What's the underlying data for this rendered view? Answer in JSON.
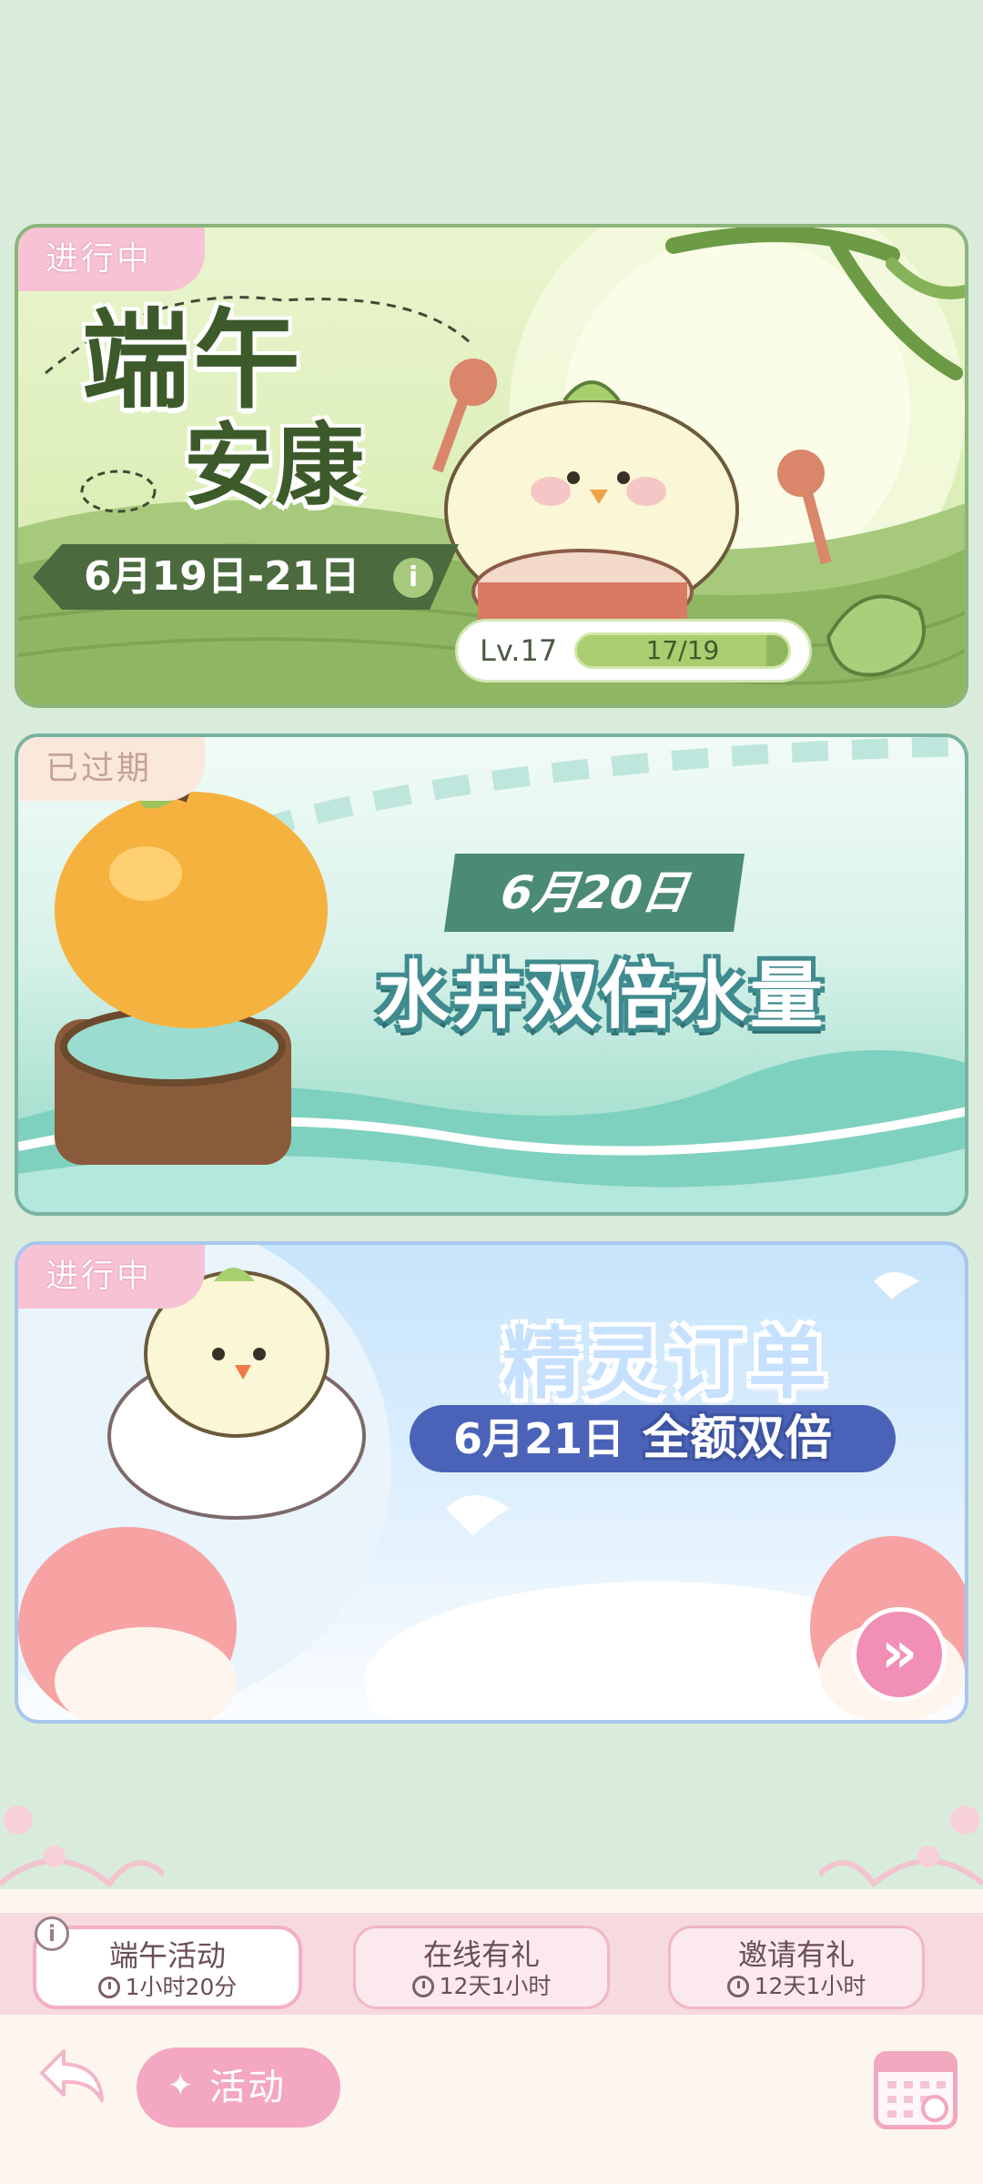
{
  "colors": {
    "page_bg": "#d9ecdb",
    "active_badge": "#f7c3d4",
    "expired_badge": "#fbe8dc",
    "accent_pink": "#f3a7c2"
  },
  "events": [
    {
      "badge": "进行中",
      "title_line1": "端午",
      "title_line2": "安康",
      "date": "6月19日-21日",
      "info_icon": "i",
      "level_label": "Lv.17",
      "progress_text": "17/19",
      "progress": 0.895
    },
    {
      "badge": "已过期",
      "date": "6月20日",
      "title": "水井双倍水量"
    },
    {
      "badge": "进行中",
      "title": "精灵订单",
      "date": "6月21日",
      "subtitle": "全额双倍",
      "arrow_icon": "»"
    }
  ],
  "tabs": [
    {
      "title": "端午活动",
      "time": "1小时20分",
      "selected": true
    },
    {
      "title": "在线有礼",
      "time": "12天1小时",
      "selected": false
    },
    {
      "title": "邀请有礼",
      "time": "12天1小时",
      "selected": false
    }
  ],
  "tabs_info_icon": "i",
  "bottom": {
    "activity_button": "活动",
    "activity_spark": "✦",
    "back_icon": "back-arrow-icon",
    "calendar_icon": "calendar-icon"
  }
}
